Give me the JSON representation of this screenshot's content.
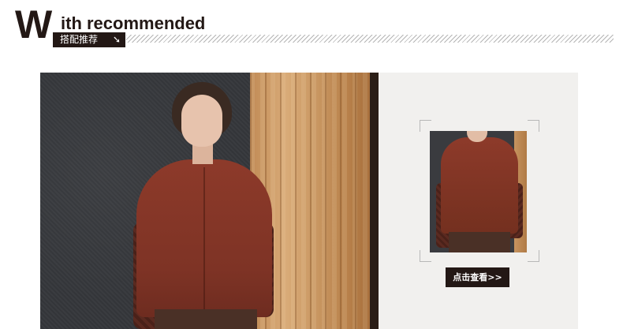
{
  "header": {
    "title_initial": "W",
    "title_rest": "ith recommended",
    "subtitle": "搭配推荐",
    "subtitle_arrow": "➘"
  },
  "side_panel": {
    "view_button_label": "点击查看>>"
  },
  "colors": {
    "dark": "#231815",
    "panel_bg": "#f1f0ee",
    "sweater": "#8d3a2a"
  }
}
